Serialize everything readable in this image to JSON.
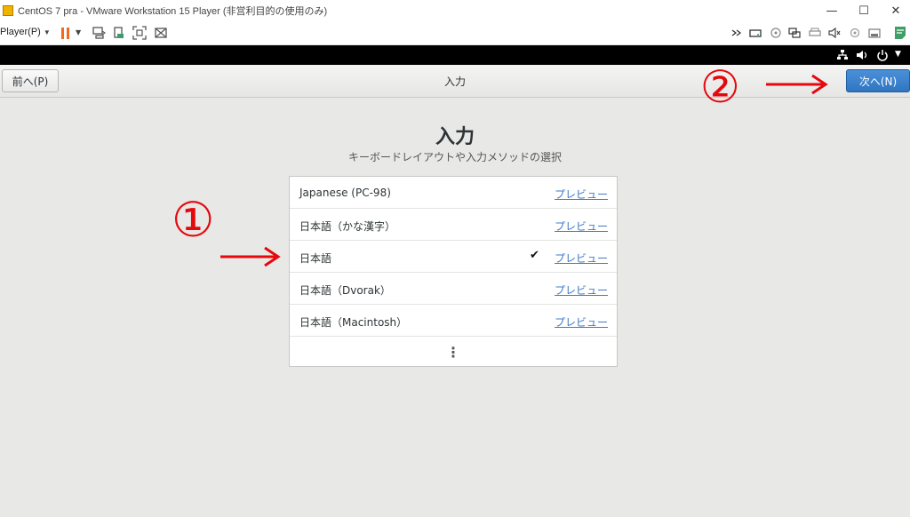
{
  "window": {
    "title": "CentOS 7 pra - VMware Workstation 15 Player (非営利目的の使用のみ)",
    "minimize_glyph": "—",
    "maximize_glyph": "☐",
    "close_glyph": "✕"
  },
  "toolbar": {
    "player_menu_label": "Player(P)",
    "icons": [
      "pause-icon",
      "send-ctrl-alt-del-icon",
      "removable-devices-icon",
      "full-screen-icon",
      "unity-icon"
    ],
    "device_icons": [
      "chevron-more-icon",
      "hard-disk-icon",
      "cd-drive-icon",
      "network-adapter-icon",
      "printer-icon",
      "sound-icon",
      "usb-icon",
      "floppy-icon",
      "message-icon"
    ]
  },
  "vm_status": {
    "icons": [
      "network-icon",
      "volume-icon",
      "power-icon"
    ]
  },
  "header": {
    "prev_label": "前へ(P)",
    "title": "入力",
    "next_label": "次へ(N)"
  },
  "main": {
    "title": "入力",
    "subtitle": "キーボードレイアウトや入力メソッドの選択",
    "rows": [
      {
        "label": "Japanese (PC-98)",
        "link": "プレビュー",
        "checked": false
      },
      {
        "label": "日本語（かな漢字）",
        "link": "プレビュー",
        "checked": false
      },
      {
        "label": "日本語",
        "link": "プレビュー",
        "checked": true
      },
      {
        "label": "日本語（Dvorak）",
        "link": "プレビュー",
        "checked": false
      },
      {
        "label": "日本語（Macintosh）",
        "link": "プレビュー",
        "checked": false
      }
    ],
    "check_glyph": "✔",
    "more_glyph": "⋮"
  },
  "annotations": {
    "marker_1": "①",
    "marker_2": "②",
    "color": "#e5080c"
  },
  "colors": {
    "next_button": "#3a83d0",
    "link": "#3d7bc9",
    "pause": "#f26a1b"
  }
}
